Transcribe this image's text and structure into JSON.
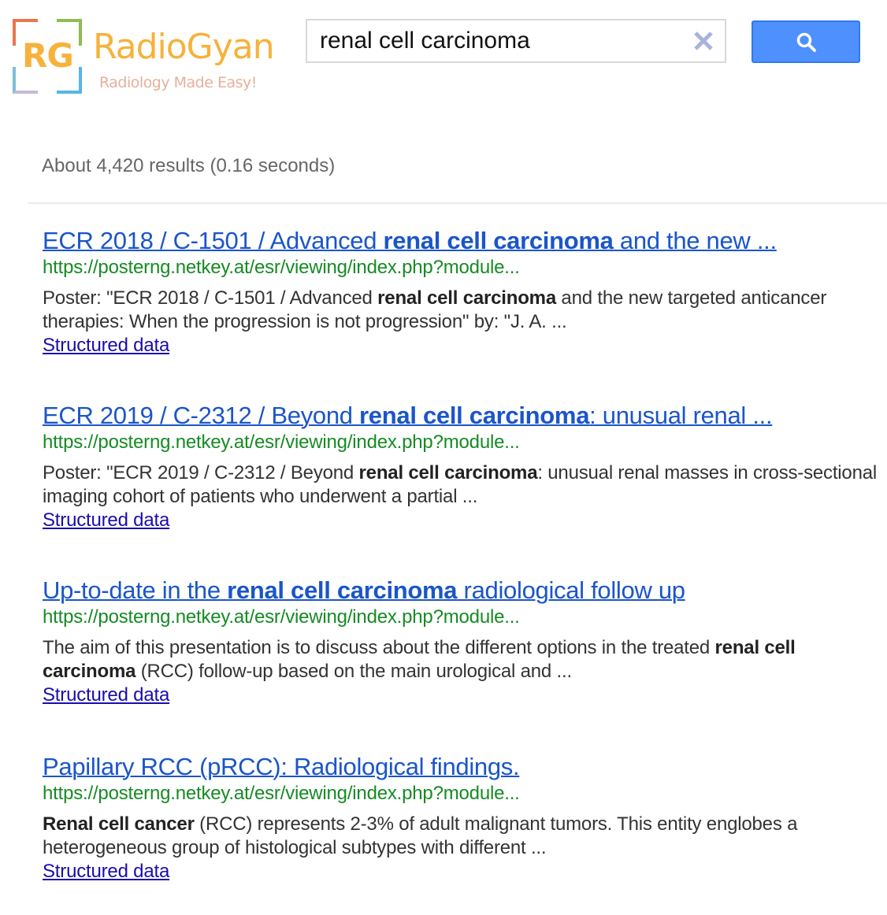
{
  "logo": {
    "initials": "RG",
    "name": "RadioGyan",
    "tagline": "Radiology Made Easy!"
  },
  "search": {
    "query": "renal cell carcinoma",
    "clear_icon": "close-icon",
    "button_icon": "search-icon"
  },
  "stats": {
    "text": "About 4,420 results (0.16 seconds)"
  },
  "colors": {
    "accent_button": "#4d90fe",
    "link_title": "#1a55c9",
    "url_green": "#168b24",
    "structured_link": "#1a0dab"
  },
  "results": [
    {
      "title_parts": [
        {
          "text": "ECR 2018 / C-1501 / Advanced ",
          "bold": false
        },
        {
          "text": "renal cell carcinoma",
          "bold": true
        },
        {
          "text": " and the new ...",
          "bold": false
        }
      ],
      "url": "https://posterng.netkey.at/esr/viewing/index.php?module...",
      "snippet_parts": [
        {
          "text": "Poster: \"ECR 2018 / C-1501 / Advanced ",
          "bold": false
        },
        {
          "text": "renal cell carcinoma",
          "bold": true
        },
        {
          "text": " and the new targeted anticancer therapies: When the progression is not progression\" by: \"J. A.  ...",
          "bold": false
        }
      ],
      "structured_label": "Structured data"
    },
    {
      "title_parts": [
        {
          "text": "ECR 2019 / C-2312 / Beyond ",
          "bold": false
        },
        {
          "text": "renal cell carcinoma",
          "bold": true
        },
        {
          "text": ": unusual renal ...",
          "bold": false
        }
      ],
      "url": "https://posterng.netkey.at/esr/viewing/index.php?module...",
      "snippet_parts": [
        {
          "text": "Poster: \"ECR 2019 / C-2312 / Beyond ",
          "bold": false
        },
        {
          "text": "renal cell carcinoma",
          "bold": true
        },
        {
          "text": ": unusual renal masses in cross-sectional imaging cohort of patients who underwent a partial ...",
          "bold": false
        }
      ],
      "structured_label": "Structured data"
    },
    {
      "title_parts": [
        {
          "text": "Up-to-date in the ",
          "bold": false
        },
        {
          "text": "renal cell carcinoma",
          "bold": true
        },
        {
          "text": " radiological follow up",
          "bold": false
        }
      ],
      "url": "https://posterng.netkey.at/esr/viewing/index.php?module...",
      "snippet_parts": [
        {
          "text": "The aim of this presentation is to discuss about the different options in the treated ",
          "bold": false
        },
        {
          "text": "renal cell carcinoma",
          "bold": true
        },
        {
          "text": " (RCC) follow-up based on the main urological and ...",
          "bold": false
        }
      ],
      "structured_label": "Structured data"
    },
    {
      "title_parts": [
        {
          "text": "Papillary RCC (pRCC): Radiological findings.",
          "bold": false
        }
      ],
      "url": "https://posterng.netkey.at/esr/viewing/index.php?module...",
      "snippet_parts": [
        {
          "text": "Renal cell cancer",
          "bold": true
        },
        {
          "text": " (RCC) represents 2-3% of adult malignant tumors. This entity englobes a heterogeneous group of histological subtypes with different ...",
          "bold": false
        }
      ],
      "structured_label": "Structured data"
    }
  ]
}
